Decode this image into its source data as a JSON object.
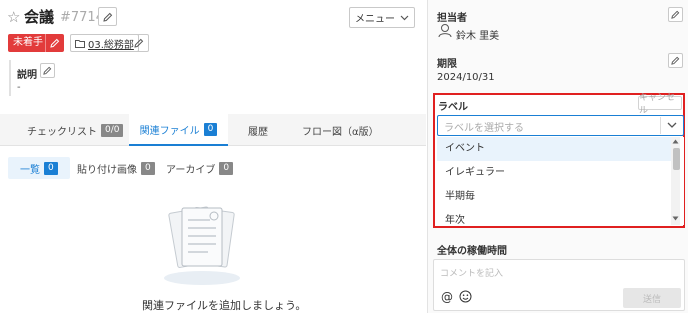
{
  "header": {
    "title": "会議",
    "ticket_number": "#7714",
    "menu_label": "メニュー"
  },
  "status": {
    "label": "未着手",
    "color": "#e23b3b"
  },
  "folder": {
    "label": "03.総務部"
  },
  "description": {
    "label": "説明",
    "value": "-"
  },
  "tabs": [
    {
      "label": "チェックリスト",
      "count": "0/0"
    },
    {
      "label": "関連ファイル",
      "count": "0"
    },
    {
      "label": "履歴"
    },
    {
      "label": "フロー図（α版）"
    }
  ],
  "subtabs": [
    {
      "label": "一覧",
      "count": "0"
    },
    {
      "label": "貼り付け画像",
      "count": "0"
    },
    {
      "label": "アーカイブ",
      "count": "0"
    }
  ],
  "empty_message": "関連ファイルを追加しましょう。",
  "sidebar": {
    "assignee_label": "担当者",
    "assignee_name": "鈴木 里美",
    "due_label": "期限",
    "due_value": "2024/10/31",
    "label_label": "ラベル",
    "cancel_label": "キャンセル",
    "select_placeholder": "ラベルを選択する",
    "options": [
      "イベント",
      "イレギュラー",
      "半期毎",
      "年次"
    ],
    "worktime_label": "全体の稼働時間",
    "comment_placeholder": "コメントを記入",
    "send_label": "送信"
  },
  "colors": {
    "accent": "#1a7fd4",
    "highlight_border": "#e02020"
  }
}
